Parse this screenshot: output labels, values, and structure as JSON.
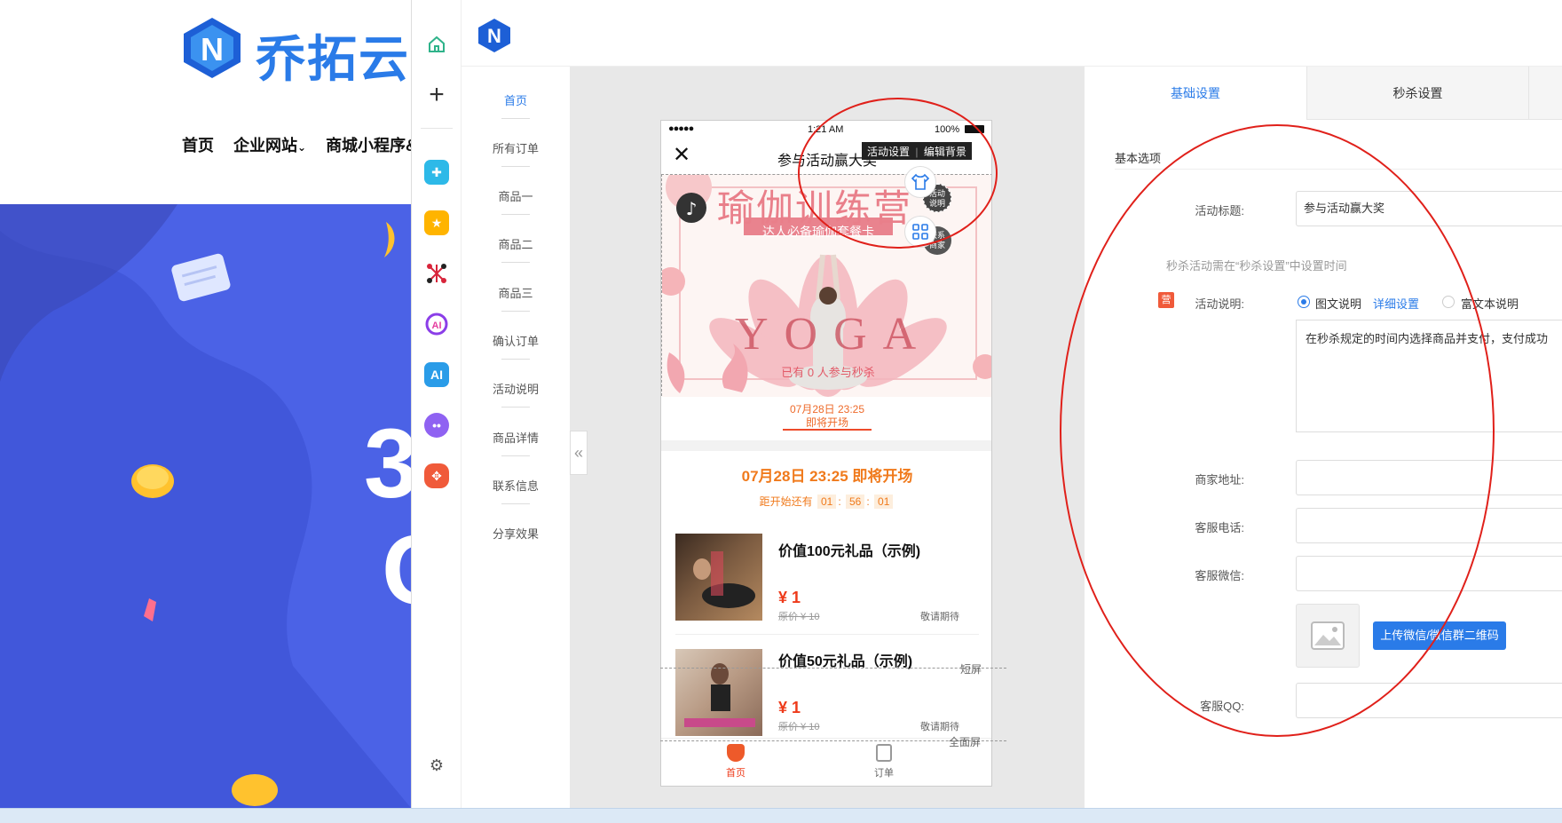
{
  "site": {
    "brand": "乔拓云.",
    "nav": [
      "首页",
      "企业网站",
      "商城小程序&"
    ]
  },
  "app": {
    "left_nav": [
      "首页",
      "所有订单",
      "商品一",
      "商品二",
      "商品三",
      "确认订单",
      "活动说明",
      "商品详情",
      "联系信息",
      "分享效果"
    ],
    "phone": {
      "status_time": "1:21 AM",
      "status_battery": "100%",
      "status_signal": "●●●●●",
      "title": "参与活动赢大奖",
      "hover_labels": [
        "活动设置",
        "编辑背景"
      ],
      "banner_title": "瑜伽训练营",
      "banner_subtitle": "达人必备瑜伽套餐卡",
      "banner_yoga": "YOGA",
      "participants": "已有 0 人参与秒杀",
      "float_btn_1": "活动\n说明",
      "float_btn_2": "联系\n商家",
      "date_small": "07月28日 23:25",
      "start_small": "即将开场",
      "section_title": "07月28日 23:25 即将开场",
      "countdown_label": "距开始还有",
      "countdown": [
        "01",
        "56",
        "01"
      ],
      "products": [
        {
          "name": "价值100元礼品（示例)",
          "price": "¥ 1",
          "orig": "原价 ¥ 10",
          "status": "敬请期待"
        },
        {
          "name": "价值50元礼品（示例)",
          "price": "¥ 1",
          "orig": "原价 ¥ 10",
          "status": "敬请期待"
        }
      ],
      "tab_home": "首页",
      "tab_orders": "订单"
    },
    "short_screen": "短屏",
    "full_screen": "全面屏",
    "tabs": [
      "基础设置",
      "秒杀设置"
    ],
    "form": {
      "section": "基本选项",
      "title_label": "活动标题:",
      "title_value": "参与活动赢大奖",
      "hint": "秒杀活动需在“秒杀设置”中设置时间",
      "desc_badge": "营",
      "desc_label": "活动说明:",
      "radio_1": "图文说明",
      "detail_link": "详细设置",
      "radio_2": "富文本说明",
      "desc_text": "在秒杀规定的时间内选择商品并支付，支付成功",
      "address_label": "商家地址:",
      "phone_label": "客服电话:",
      "wechat_label": "客服微信:",
      "upload_button": "上传微信/微信群二维码",
      "qq_label": "客服QQ:"
    }
  }
}
